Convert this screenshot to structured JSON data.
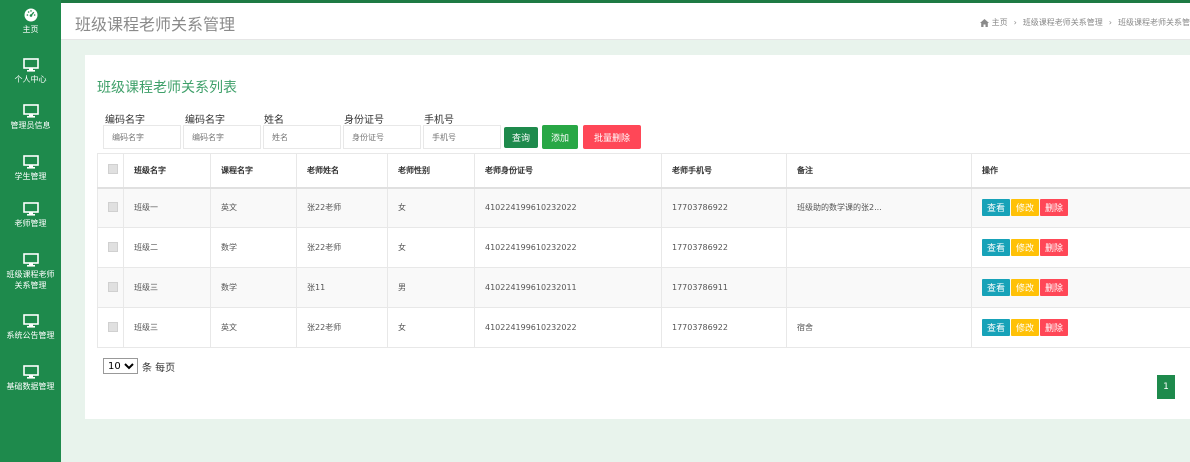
{
  "sidebar": {
    "items": [
      {
        "label": "主页",
        "icon": "dashboard-icon"
      },
      {
        "label": "个人中心",
        "icon": "monitor-icon"
      },
      {
        "label": "管理员信息",
        "icon": "monitor-icon"
      },
      {
        "label": "学生管理",
        "icon": "monitor-icon"
      },
      {
        "label": "老师管理",
        "icon": "monitor-icon"
      },
      {
        "label": "班级课程老师\n关系管理",
        "icon": "monitor-icon"
      },
      {
        "label": "系统公告管理",
        "icon": "monitor-icon"
      },
      {
        "label": "基础数据管理",
        "icon": "monitor-icon"
      }
    ]
  },
  "header": {
    "title": "班级课程老师关系管理",
    "breadcrumb": {
      "home": "主页",
      "sep": "›",
      "level1": "班级课程老师关系管理",
      "level2": "班级课程老师关系管"
    }
  },
  "card": {
    "title": "班级课程老师关系列表"
  },
  "filters": [
    {
      "label": "编码名字",
      "placeholder": "编码名字"
    },
    {
      "label": "编码名字",
      "placeholder": "编码名字"
    },
    {
      "label": "姓名",
      "placeholder": "姓名"
    },
    {
      "label": "身份证号",
      "placeholder": "身份证号"
    },
    {
      "label": "手机号",
      "placeholder": "手机号"
    }
  ],
  "buttons": {
    "query": "查询",
    "add": "添加",
    "batch_delete": "批量删除"
  },
  "table": {
    "headers": [
      "班级名字",
      "课程名字",
      "老师姓名",
      "老师性别",
      "老师身份证号",
      "老师手机号",
      "备注",
      "操作"
    ],
    "rows": [
      {
        "cells": [
          "班级一",
          "英文",
          "张22老师",
          "女",
          "410224199610232022",
          "17703786922",
          "班级助的数学课的张2..."
        ]
      },
      {
        "cells": [
          "班级二",
          "数学",
          "张22老师",
          "女",
          "410224199610232022",
          "17703786922",
          ""
        ]
      },
      {
        "cells": [
          "班级三",
          "数学",
          "张11",
          "男",
          "410224199610232011",
          "17703786911",
          ""
        ]
      },
      {
        "cells": [
          "班级三",
          "英文",
          "张22老师",
          "女",
          "410224199610232022",
          "17703786922",
          "宿舍"
        ]
      }
    ],
    "ops": {
      "view": "查看",
      "edit": "修改",
      "delete": "删除"
    }
  },
  "pagination": {
    "page_size": "10",
    "page_size_suffix": "条 每页",
    "current_page": "1"
  },
  "colors": {
    "sidebar": "#1e8a4c",
    "accent": "#3fa06a",
    "query": "#1e8a4c",
    "add": "#28a745",
    "danger": "#ff4757",
    "view": "#17a2b8",
    "edit": "#ffc107"
  }
}
